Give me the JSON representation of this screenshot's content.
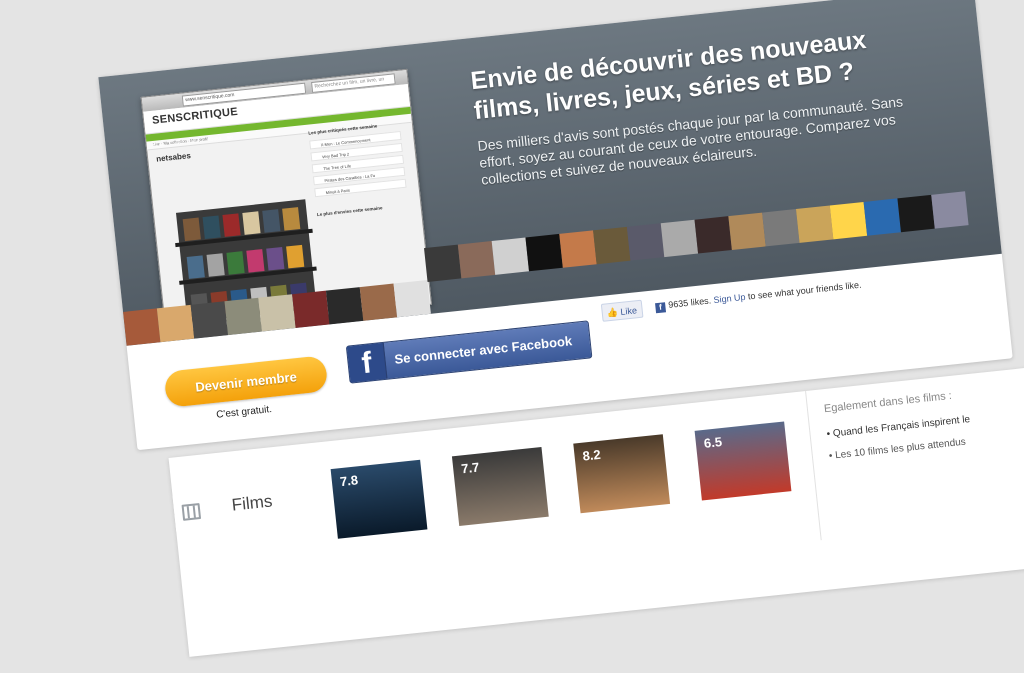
{
  "hero": {
    "title": "Envie de découvrir des nouveaux films, livres, jeux, séries et BD ?",
    "subtitle": "Des milliers d'avis sont postés chaque jour par la communauté. Sans effort, soyez au courant de ceux de votre entourage. Comparez vos collections et suivez de nouveaux éclaireurs."
  },
  "browser": {
    "url": "www.senscritique.com",
    "search": "Recherchez un film, un livre, un jeu...",
    "logo": "SENSCRITIQUE",
    "nav": [
      "FILMS",
      "LIVRES",
      "JEUX",
      "SÉRIES",
      "BD"
    ],
    "subnav": "Live · Ma collection · Mon profil",
    "username": "netsabes",
    "side_heading_1": "Les plus critiqués cette semaine",
    "side_heading_2": "Le plus d'envies cette semaine",
    "side_rows": [
      "X-Men : Le Commencement",
      "Very Bad Trip 2",
      "The Tree of Life",
      "Pirates des Caraïbes : La Fo",
      "Minuit à Paris"
    ]
  },
  "actions": {
    "member_button": "Devenir membre",
    "member_note": "C'est gratuit.",
    "facebook_icon_letter": "f",
    "facebook_button": "Se connecter avec Facebook",
    "like_button": "Like",
    "likes_text": "9635 likes.",
    "signup_link": "Sign Up",
    "signup_suffix": "to see what your friends like."
  },
  "films": {
    "title": "Films",
    "scores": [
      "7.8",
      "7.7",
      "8.2",
      "6.5"
    ]
  },
  "also": {
    "title": "Egalement dans les films :",
    "items": [
      "Quand les Français inspirent le",
      "Les 10 films les plus attendus"
    ]
  },
  "colors": {
    "hero_bg": "#5a646d",
    "member_orange": "#f7a814",
    "facebook_blue": "#3b5998",
    "nav_green": "#74b72e"
  }
}
